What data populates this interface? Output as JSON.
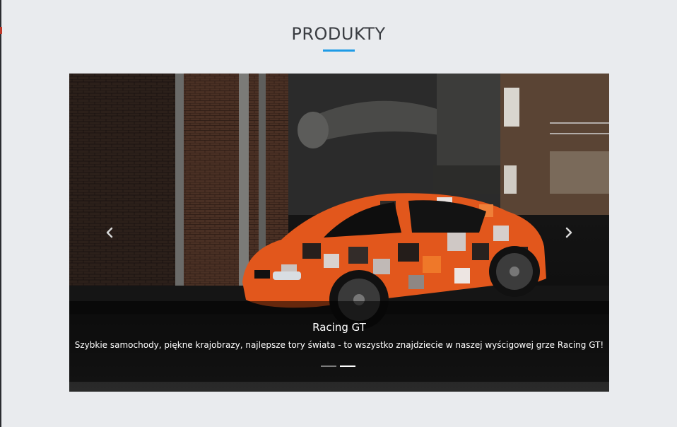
{
  "section": {
    "title": "PRODUKTY"
  },
  "carousel": {
    "active_index": 1,
    "slides_count": 2,
    "slide": {
      "title": "Racing GT",
      "description": "Szybkie samochody, piękne krajobrazy, najlepsze tory świata - to wszystko znajdziecie w naszej wyścigowej grze Racing GT!"
    },
    "controls": {
      "prev_icon": "chevron-left-icon",
      "next_icon": "chevron-right-icon"
    }
  },
  "colors": {
    "page_background": "#e9ebee",
    "accent": "#1e9be6",
    "title_text": "#3a3d42"
  }
}
